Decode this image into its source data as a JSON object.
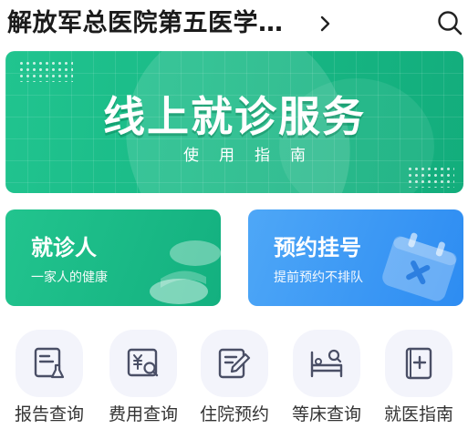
{
  "header": {
    "hospital_name": "解放军总医院第五医学…",
    "chevron_icon": "chevron-right-icon",
    "search_icon": "search-icon"
  },
  "banner": {
    "title": "线上就诊服务",
    "subtitle": "使用指南"
  },
  "cards": [
    {
      "title": "就诊人",
      "subtitle": "一家人的健康",
      "color": "#1db886"
    },
    {
      "title": "预约挂号",
      "subtitle": "提前预约不排队",
      "color": "#3a96f4"
    }
  ],
  "services": [
    {
      "label": "报告查询",
      "icon": "report-flask-icon"
    },
    {
      "label": "费用查询",
      "icon": "fee-search-icon"
    },
    {
      "label": "住院预约",
      "icon": "edit-document-icon"
    },
    {
      "label": "等床查询",
      "icon": "bed-search-icon"
    },
    {
      "label": "就医指南",
      "icon": "guide-book-icon"
    }
  ],
  "colors": {
    "accent_green": "#1db886",
    "accent_blue": "#3a96f4",
    "icon_stroke": "#4a4f66",
    "tile_bg": "#f3f4fb"
  }
}
